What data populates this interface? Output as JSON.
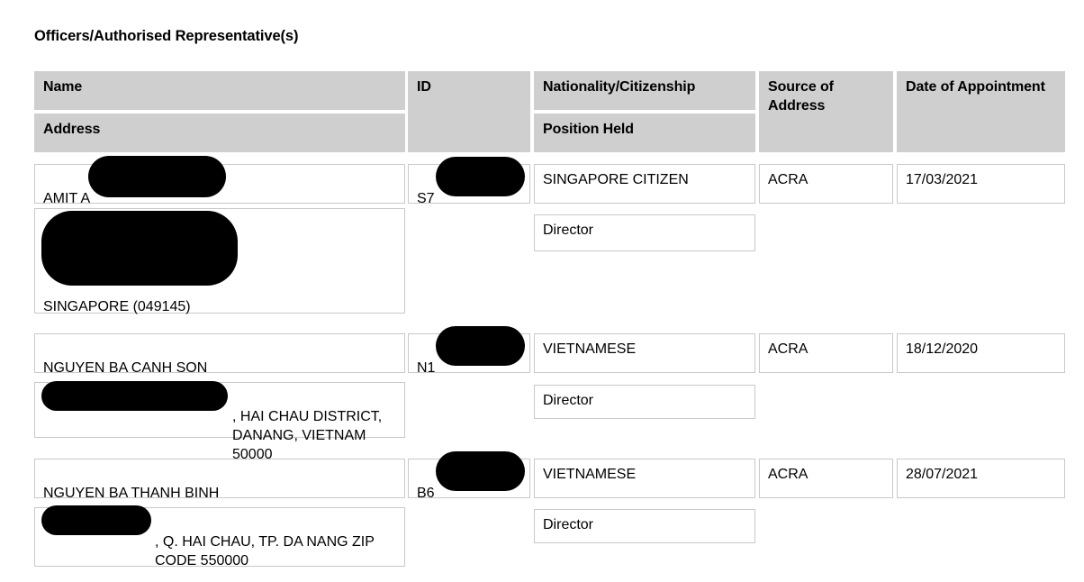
{
  "document": {
    "section_title": "Officers/Authorised Representative(s)"
  },
  "table": {
    "headers": {
      "name": "Name",
      "address": "Address",
      "id": "ID",
      "nationality": "Nationality/Citizenship",
      "position": "Position Held",
      "source_of_address": "Source of\nAddress",
      "date_of_appointment": "Date of Appointment"
    },
    "rows": [
      {
        "name": "AMIT A",
        "name_redacted": true,
        "address_line_visible": "SINGAPORE (049145)",
        "address_redacted": true,
        "id": "S7",
        "id_redacted": true,
        "nationality": "SINGAPORE CITIZEN",
        "position": "Director",
        "source_of_address": "ACRA",
        "date_of_appointment": "17/03/2021"
      },
      {
        "name": "NGUYEN BA CANH SON",
        "name_redacted": false,
        "address_line_visible": ", HAI CHAU DISTRICT,\nDANANG, VIETNAM 50000",
        "address_redacted": true,
        "id": "N1",
        "id_redacted": true,
        "nationality": "VIETNAMESE",
        "position": "Director",
        "source_of_address": "ACRA",
        "date_of_appointment": "18/12/2020"
      },
      {
        "name": "NGUYEN BA THANH BINH",
        "name_redacted": false,
        "address_line_visible": ", Q. HAI CHAU, TP. DA NANG ZIP\nCODE 550000",
        "address_redacted": true,
        "id": "B6",
        "id_redacted": true,
        "nationality": "VIETNAMESE",
        "position": "Director",
        "source_of_address": "ACRA",
        "date_of_appointment": "28/07/2021"
      }
    ]
  },
  "colors": {
    "header_fill": "#cfcfcf",
    "cell_border": "#c9c9c9",
    "redaction": "#000000",
    "text": "#000000",
    "background": "#ffffff"
  }
}
